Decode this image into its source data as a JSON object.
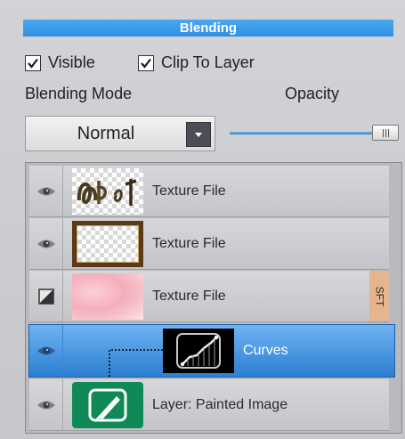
{
  "panel": {
    "title": "Blending",
    "visible_label": "Visible",
    "visible_checked": true,
    "clip_label": "Clip To Layer",
    "clip_checked": true,
    "blend_mode_label": "Blending Mode",
    "opacity_label": "Opacity",
    "blend_mode_value": "Normal",
    "opacity_fraction": 1.0
  },
  "layers": [
    {
      "name": "Texture File",
      "visibility_icon": "eye-icon",
      "thumb": "calligraphy-texture"
    },
    {
      "name": "Texture File",
      "visibility_icon": "eye-icon",
      "thumb": "frame-texture"
    },
    {
      "name": "Texture File",
      "visibility_icon": "mask-icon",
      "thumb": "pink-watercolor",
      "tag": "SFT"
    },
    {
      "name": "Curves",
      "visibility_icon": "eye-icon",
      "thumb": "curves-graph",
      "selected": true
    },
    {
      "name": "Layer: Painted Image",
      "visibility_icon": "eye-icon",
      "thumb": "brush-icon"
    }
  ],
  "colors": {
    "accent": "#2f8fe0",
    "selected_row": "#3d8ee0",
    "sft_tag": "#e4b58f",
    "painted_image_icon": "#0f8a57"
  }
}
